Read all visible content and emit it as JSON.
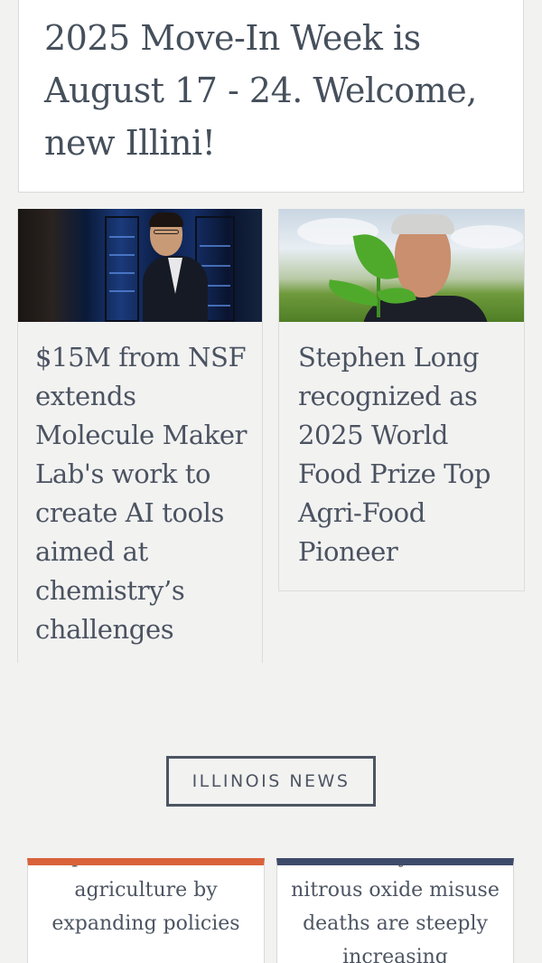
{
  "hero": {
    "headline": "2025 Move-In Week is August 17 - 24. Welcome, new Illini!"
  },
  "stories": [
    {
      "title": "$15M from NSF extends Molecule Maker Lab's work to create AI tools aimed at chemistry’s challenges",
      "image": "researcher-in-server-room-photo"
    },
    {
      "title": "Stephen Long recognized as 2025 World Food Prize Top Agri-Food Pioneer",
      "image": "man-holding-seedling-in-field-photo"
    }
  ],
  "section": {
    "label": "ILLINOIS NEWS"
  },
  "news_cards": [
    {
      "text": "Paper: Decarbonize agriculture by expanding policies",
      "accent": "#d9623b"
    },
    {
      "text": "New study reveals nitrous oxide misuse deaths are steeply increasing",
      "accent": "#3f4b6b"
    }
  ],
  "colors": {
    "background": "#f2f2f1",
    "text": "#4d5562",
    "card": "#ffffff"
  }
}
